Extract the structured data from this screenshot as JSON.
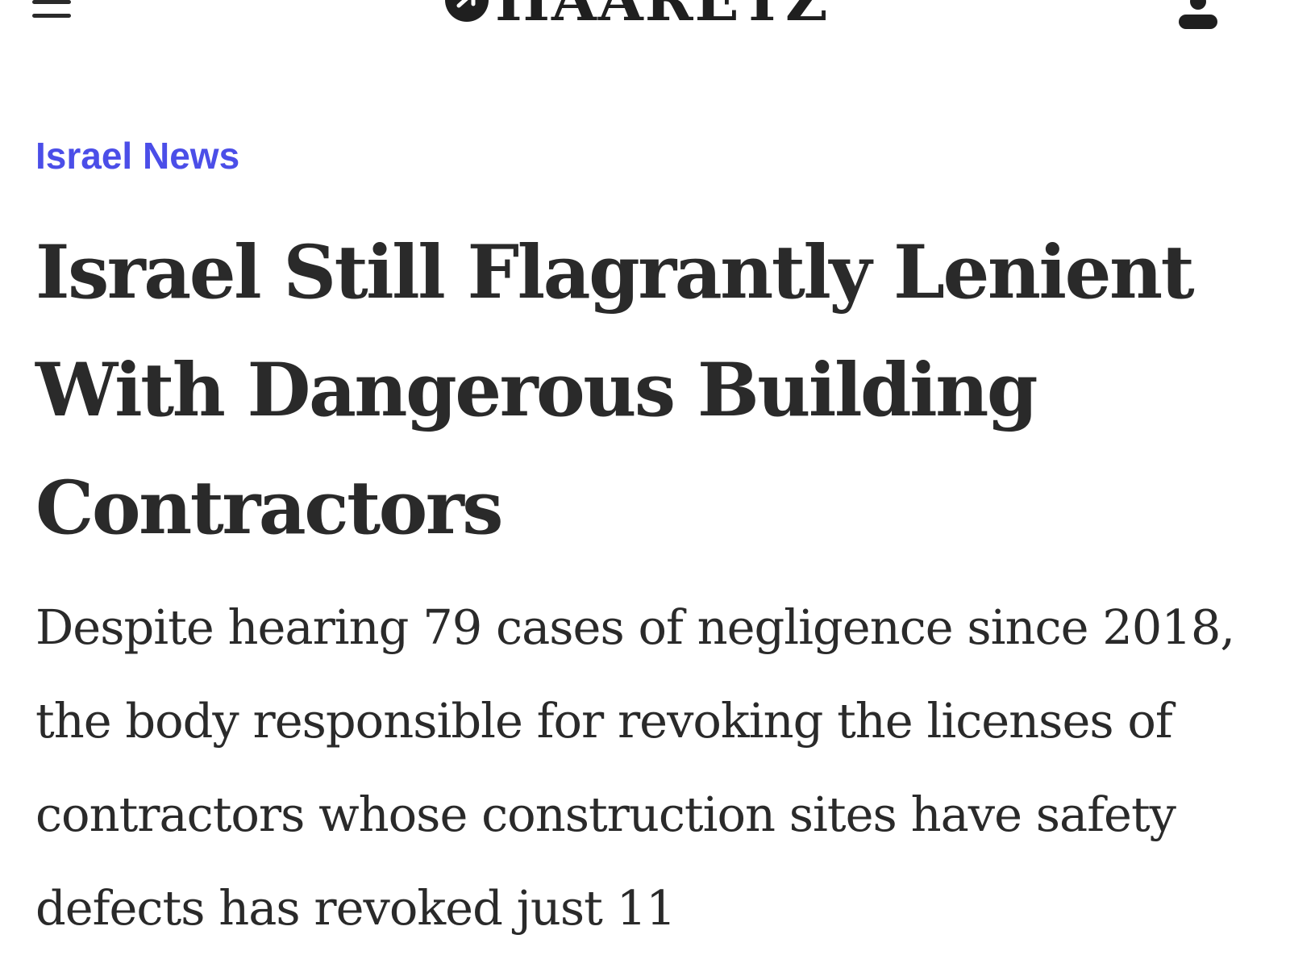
{
  "header": {
    "logo_text": "HAARETZ",
    "menu_icon": "hamburger-menu-icon",
    "user_icon": "user-account-icon"
  },
  "article": {
    "section": "Israel News",
    "headline": "Israel Still Flagrantly Lenient With Dangerous Building Contractors",
    "dek": "Despite hearing 79 cases of negligence since 2018, the body responsible for revoking the licenses of contractors whose construction sites have safety defects has revoked just 11"
  },
  "colors": {
    "section_link": "#4b4ee8",
    "text": "#2a2a2a",
    "background": "#ffffff"
  }
}
